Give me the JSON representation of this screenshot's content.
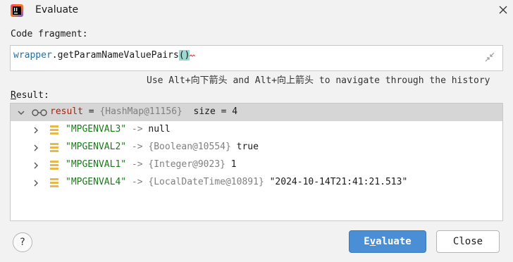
{
  "window": {
    "title": "Evaluate"
  },
  "code_fragment": {
    "label": "Code fragment:",
    "prefix": "wrapper",
    "dot": ".",
    "method": "getParamNameValuePairs",
    "parens": "()"
  },
  "hint": "Use Alt+向下箭头 and Alt+向上箭头 to navigate through the history",
  "result": {
    "label": "Result:",
    "root": {
      "name": "result",
      "eq": " = ",
      "ref": "{HashMap@11156}",
      "size": "  size = 4"
    },
    "entries": [
      {
        "key": "\"MPGENVAL3\"",
        "arrow": " -> ",
        "ref": "",
        "value": "null"
      },
      {
        "key": "\"MPGENVAL2\"",
        "arrow": " -> ",
        "ref": "{Boolean@10554}",
        "value": " true"
      },
      {
        "key": "\"MPGENVAL1\"",
        "arrow": " -> ",
        "ref": "{Integer@9023}",
        "value": " 1"
      },
      {
        "key": "\"MPGENVAL4\"",
        "arrow": " -> ",
        "ref": "{LocalDateTime@10891}",
        "value": " \"2024-10-14T21:41:21.513\""
      }
    ]
  },
  "buttons": {
    "help": "?",
    "evaluate_u": "E",
    "evaluate_v": "v",
    "evaluate_rest": "aluate",
    "close": "Close"
  },
  "icons": {
    "app": "intellij-logo-icon",
    "close": "close-icon",
    "collapse": "collapse-icon",
    "expand": "chevron-right-icon",
    "collapse_tree": "chevron-down-icon",
    "watch": "glasses-icon",
    "field": "field-icon"
  },
  "colors": {
    "accent": "#4a8fd6",
    "string": "#1a7a1a",
    "variable": "#a8230f",
    "reference": "#808080",
    "code": "#1f6fa8"
  }
}
